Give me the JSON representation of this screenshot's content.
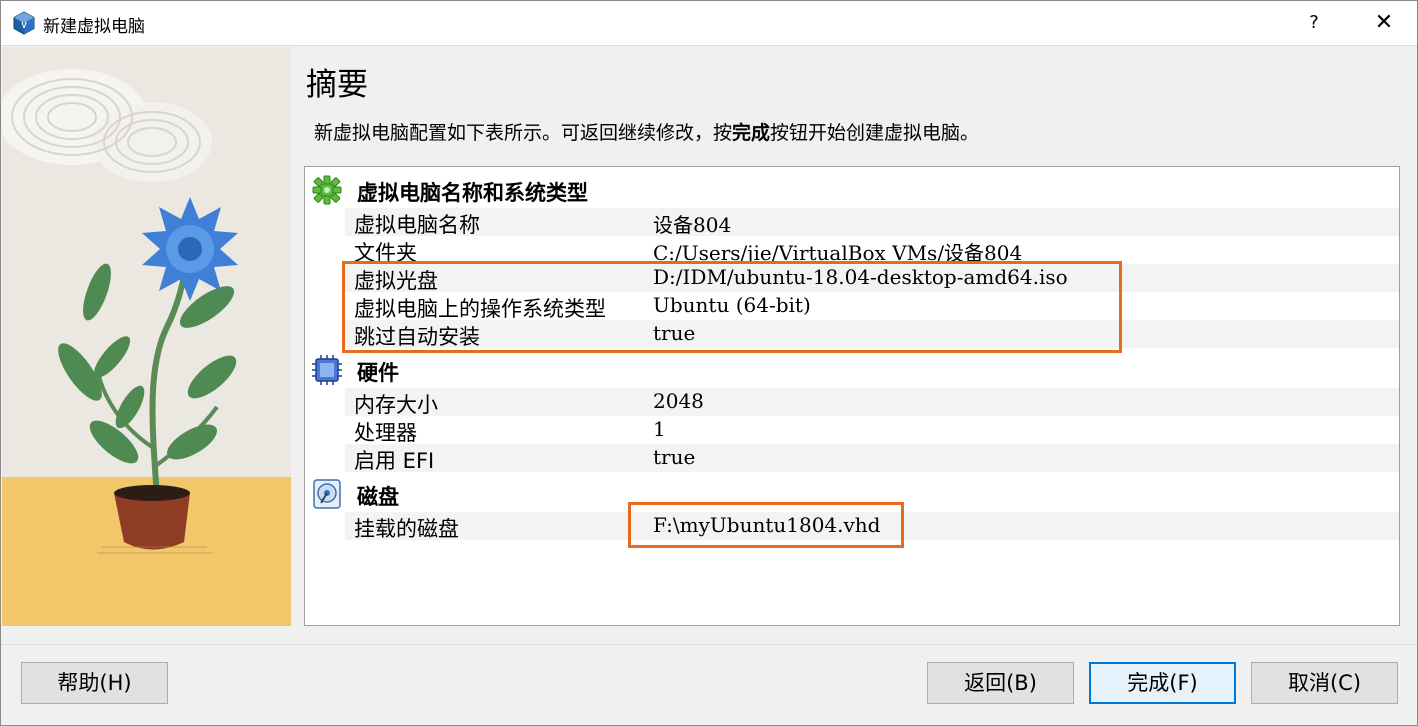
{
  "window": {
    "title": "新建虚拟电脑",
    "help_glyph": "?",
    "close_glyph": "✕"
  },
  "page": {
    "heading": "摘要",
    "description_before": "新虚拟电脑配置如下表所示。可返回继续修改，按",
    "description_bold": "完成",
    "description_after": "按钮开始创建虚拟电脑。"
  },
  "sections": {
    "general": {
      "title": "虚拟电脑名称和系统类型",
      "icon": "green-gear-icon",
      "rows": [
        {
          "key": "虚拟电脑名称",
          "value": "设备804"
        },
        {
          "key": "文件夹",
          "value": "C:/Users/jie/VirtualBox VMs/设备804"
        },
        {
          "key": "虚拟光盘",
          "value": "D:/IDM/ubuntu-18.04-desktop-amd64.iso"
        },
        {
          "key": "虚拟电脑上的操作系统类型",
          "value": "Ubuntu (64-bit)"
        },
        {
          "key": "跳过自动安装",
          "value": "true"
        }
      ]
    },
    "hardware": {
      "title": "硬件",
      "icon": "chip-icon",
      "rows": [
        {
          "key": "内存大小",
          "value": "2048"
        },
        {
          "key": "处理器",
          "value": "1"
        },
        {
          "key": "启用 EFI",
          "value": "true"
        }
      ]
    },
    "disk": {
      "title": "磁盘",
      "icon": "hard-disk-icon",
      "rows": [
        {
          "key": "挂载的磁盘",
          "value": "F:\\myUbuntu1804.vhd"
        }
      ]
    }
  },
  "buttons": {
    "help": "帮助(H)",
    "back": "返回(B)",
    "finish": "完成(F)",
    "cancel": "取消(C)"
  },
  "colors": {
    "highlight": "#e86a1f",
    "default_button_border": "#0078d7",
    "row_alt": "#f3f3f3"
  }
}
